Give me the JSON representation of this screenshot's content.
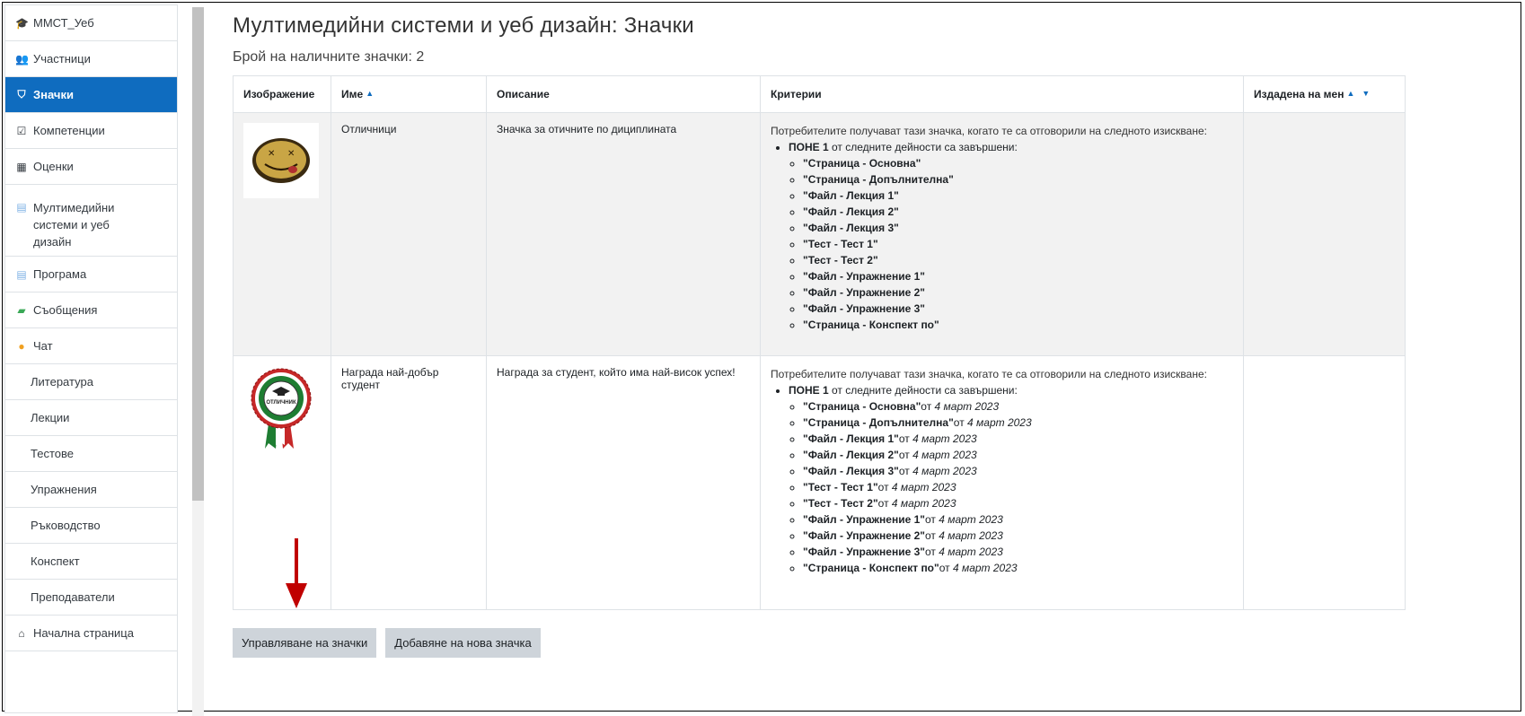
{
  "sidebar": {
    "items": [
      {
        "label": "ММСТ_Уеб",
        "icon": "graduation-cap-icon"
      },
      {
        "label": "Участници",
        "icon": "users-icon"
      },
      {
        "label": "Значки",
        "icon": "shield-icon",
        "active": true
      },
      {
        "label": "Компетенции",
        "icon": "checkbox-icon"
      },
      {
        "label": "Оценки",
        "icon": "table-icon"
      },
      {
        "label": "Мултимедийни системи и уеб дизайн",
        "icon": "folder-icon"
      },
      {
        "label": "Програма",
        "icon": "folder-icon"
      },
      {
        "label": "Съобщения",
        "icon": "forum-icon"
      },
      {
        "label": "Чат",
        "icon": "chat-icon"
      },
      {
        "label": "Литература"
      },
      {
        "label": "Лекции"
      },
      {
        "label": "Тестове"
      },
      {
        "label": "Упражнения"
      },
      {
        "label": "Ръководство"
      },
      {
        "label": "Конспект"
      },
      {
        "label": "Преподаватели"
      },
      {
        "label": "Начална страница",
        "icon": "home-icon"
      }
    ]
  },
  "page": {
    "title": "Мултимедийни системи и уеб дизайн: Значки",
    "count_label": "Брой на наличните значки: 2"
  },
  "table": {
    "headers": {
      "image": "Изображение",
      "name": "Име",
      "description": "Описание",
      "criteria": "Критерии",
      "issued": "Издадена на мен"
    },
    "rows": [
      {
        "name": "Отличници",
        "description": "Значка за отичните по дициплината",
        "criteria_intro": "Потребителите получават тази значка, когато те са отговорили на следното изискване:",
        "criteria_any_bold": "ПОНЕ 1",
        "criteria_any_rest": " от следните дейности са завършени:",
        "activities": [
          {
            "name": "\"Страница - Основна\"",
            "date_prefix": "",
            "date": ""
          },
          {
            "name": "\"Страница - Допълнителна\"",
            "date_prefix": "",
            "date": ""
          },
          {
            "name": "\"Файл - Лекция 1\"",
            "date_prefix": "",
            "date": ""
          },
          {
            "name": "\"Файл - Лекция 2\"",
            "date_prefix": "",
            "date": ""
          },
          {
            "name": "\"Файл - Лекция 3\"",
            "date_prefix": "",
            "date": ""
          },
          {
            "name": "\"Тест - Тест 1\"",
            "date_prefix": "",
            "date": ""
          },
          {
            "name": "\"Тест - Тест 2\"",
            "date_prefix": "",
            "date": ""
          },
          {
            "name": "\"Файл - Упражнение 1\"",
            "date_prefix": "",
            "date": ""
          },
          {
            "name": "\"Файл - Упражнение 2\"",
            "date_prefix": "",
            "date": ""
          },
          {
            "name": "\"Файл - Упражнение 3\"",
            "date_prefix": "",
            "date": ""
          },
          {
            "name": "\"Страница - Конспект по\"",
            "date_prefix": "",
            "date": ""
          }
        ]
      },
      {
        "name": "Награда най-добър студент",
        "description": "Награда за студент, който има най-висок успех!",
        "badge_text": "ОТЛИЧНИК",
        "criteria_intro": "Потребителите получават тази значка, когато те са отговорили на следното изискване:",
        "criteria_any_bold": "ПОНЕ 1",
        "criteria_any_rest": " от следните дейности са завършени:",
        "activities": [
          {
            "name": "\"Страница - Основна\"",
            "date_prefix": "от ",
            "date": "4 март 2023"
          },
          {
            "name": "\"Страница - Допълнителна\"",
            "date_prefix": "от ",
            "date": "4 март 2023"
          },
          {
            "name": "\"Файл - Лекция 1\"",
            "date_prefix": "от ",
            "date": "4 март 2023"
          },
          {
            "name": "\"Файл - Лекция 2\"",
            "date_prefix": "от ",
            "date": "4 март 2023"
          },
          {
            "name": "\"Файл - Лекция 3\"",
            "date_prefix": "от ",
            "date": "4 март 2023"
          },
          {
            "name": "\"Тест - Тест 1\"",
            "date_prefix": "от ",
            "date": "4 март 2023"
          },
          {
            "name": "\"Тест - Тест 2\"",
            "date_prefix": "от ",
            "date": "4 март 2023"
          },
          {
            "name": "\"Файл - Упражнение 1\"",
            "date_prefix": "от ",
            "date": "4 март 2023"
          },
          {
            "name": "\"Файл - Упражнение 2\"",
            "date_prefix": "от ",
            "date": "4 март 2023"
          },
          {
            "name": "\"Файл - Упражнение 3\"",
            "date_prefix": "от ",
            "date": "4 март 2023"
          },
          {
            "name": "\"Страница - Конспект по\"",
            "date_prefix": "от ",
            "date": "4 март 2023"
          }
        ]
      }
    ]
  },
  "buttons": {
    "manage": "Управляване на значки",
    "add": "Добавяне на нова значка"
  },
  "colors": {
    "accent": "#0f6cbf",
    "arrow": "#c00000"
  }
}
